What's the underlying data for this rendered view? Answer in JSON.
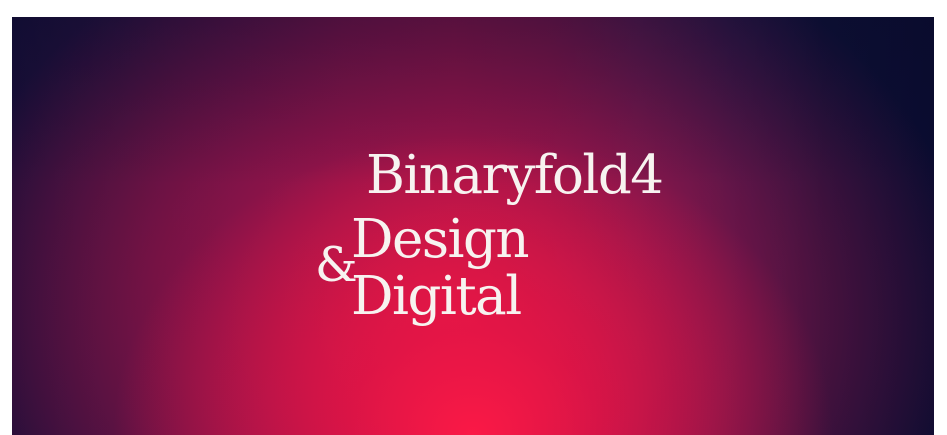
{
  "hero": {
    "colors": {
      "edge": "#0d0e38",
      "center_glow": "#ff1a46",
      "text": "#f7f3f0"
    },
    "wordmark": {
      "line1": "Binaryfold4",
      "line2": "Design",
      "ampersand": "&",
      "line3": "Digital"
    }
  }
}
